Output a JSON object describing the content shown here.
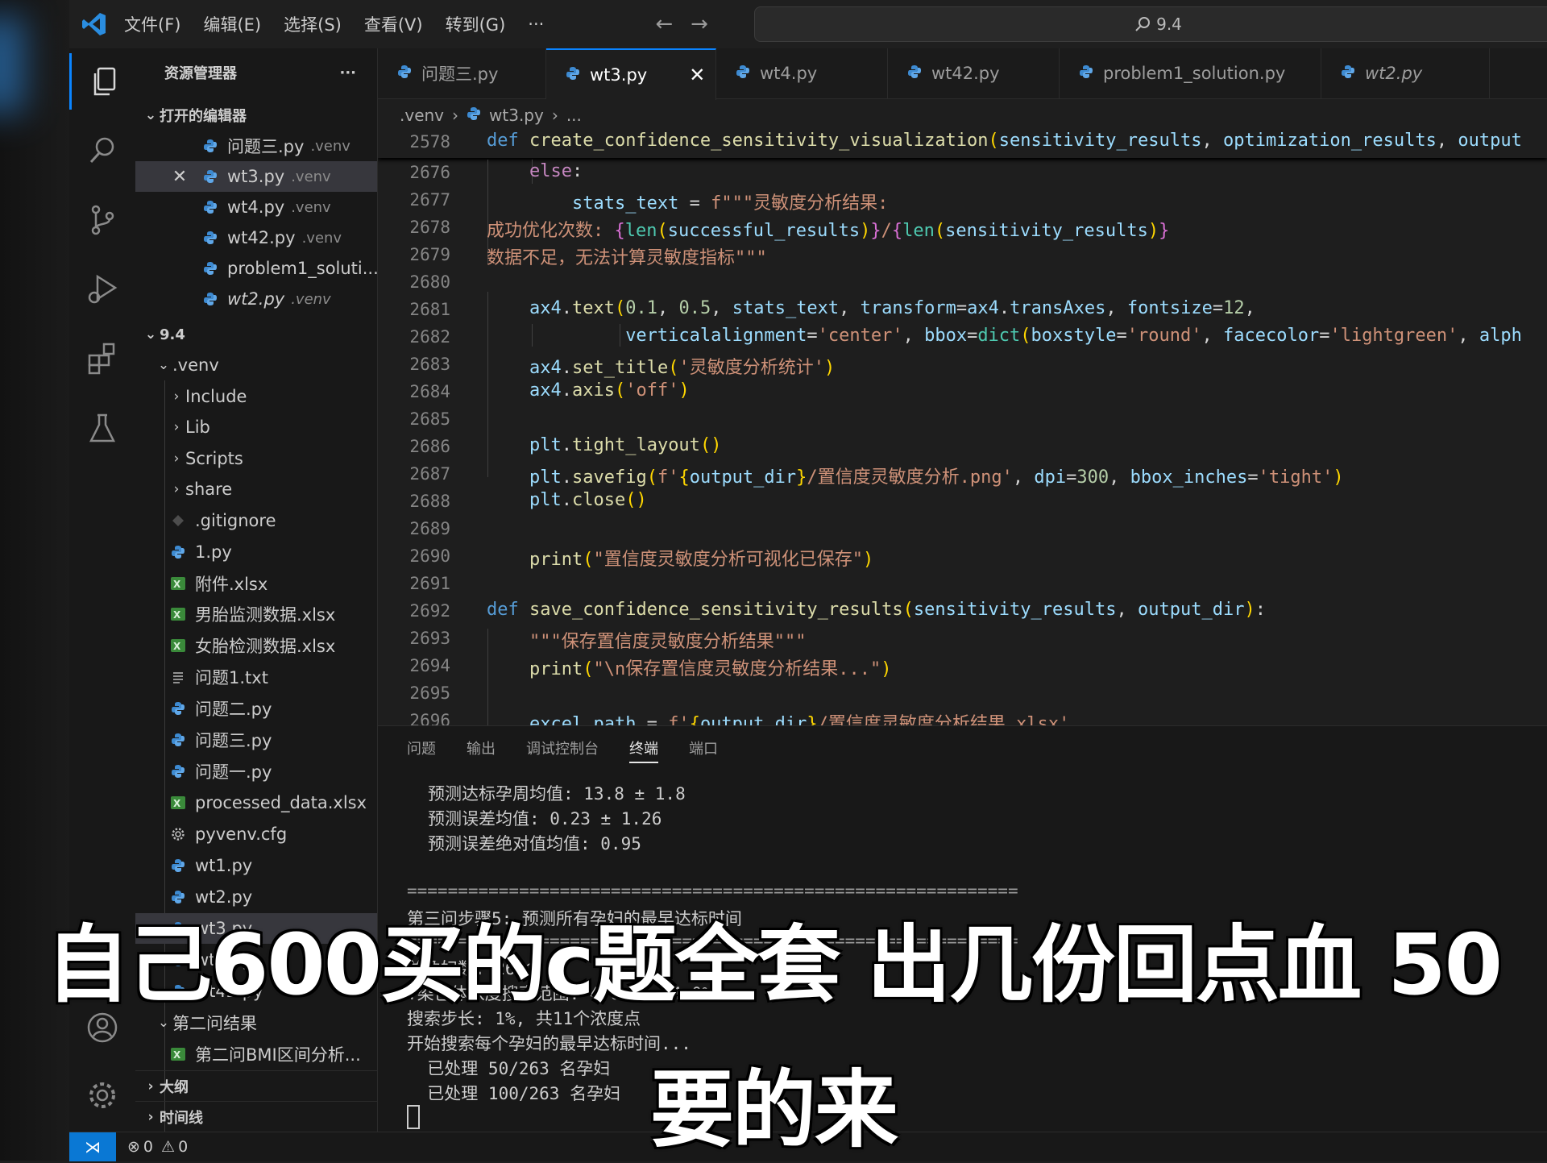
{
  "menu": [
    "文件(F)",
    "编辑(E)",
    "选择(S)",
    "查看(V)",
    "转到(G)",
    "···"
  ],
  "search": {
    "text": "9.4"
  },
  "sidebar": {
    "title": "资源管理器",
    "more": "···",
    "open_editors_label": "打开的编辑器",
    "open_editors": [
      {
        "name": "问题三.py",
        "meta": ".venv"
      },
      {
        "name": "wt3.py",
        "meta": ".venv"
      },
      {
        "name": "wt4.py",
        "meta": ".venv"
      },
      {
        "name": "wt42.py",
        "meta": ".venv"
      },
      {
        "name": "problem1_soluti...",
        "meta": ""
      },
      {
        "name": "wt2.py",
        "meta": ".venv"
      }
    ],
    "folder_label": "9.4",
    "venv_label": ".venv",
    "venv_children": [
      "Include",
      "Lib",
      "Scripts",
      "share"
    ],
    "files": [
      ".gitignore",
      "1.py",
      "附件.xlsx",
      "男胎监测数据.xlsx",
      "女胎检测数据.xlsx",
      "问题1.txt",
      "问题二.py",
      "问题三.py",
      "问题一.py",
      "processed_data.xlsx",
      "pyvenv.cfg",
      "wt1.py",
      "wt2.py",
      "wt3.py",
      "wt4.py",
      "wt42.py"
    ],
    "subfolder_label": "第二问结果",
    "subfolder_file": "第二问BMI区间分析...",
    "outline_label": "大纲",
    "timeline_label": "时间线"
  },
  "tabs": [
    {
      "label": "问题三.py"
    },
    {
      "label": "wt3.py",
      "close": "✕"
    },
    {
      "label": "wt4.py"
    },
    {
      "label": "wt42.py"
    },
    {
      "label": "problem1_solution.py"
    },
    {
      "label": "wt2.py"
    }
  ],
  "breadcrumb": {
    "folder": ".venv",
    "file": "wt3.py",
    "more": "..."
  },
  "editor": {
    "line_numbers": [
      "2578",
      "2676",
      "2677",
      "2678",
      "2679",
      "2680",
      "2681",
      "2682",
      "2683",
      "2684",
      "2685",
      "2686",
      "2687",
      "2688",
      "2689",
      "2690",
      "2691",
      "2692",
      "2693",
      "2694",
      "2695",
      "2696"
    ],
    "lines": [
      "def create_confidence_sensitivity_visualization(sensitivity_results, optimization_results, output",
      "    else:",
      "        stats_text = f\"\"\"灵敏度分析结果:",
      "成功优化次数: {len(successful_results)}/{len(sensitivity_results)}",
      "数据不足，无法计算灵敏度指标\"\"\"",
      "",
      "    ax4.text(0.1, 0.5, stats_text, transform=ax4.transAxes, fontsize=12,",
      "             verticalalignment='center', bbox=dict(boxstyle='round', facecolor='lightgreen', alph",
      "    ax4.set_title('灵敏度分析统计')",
      "    ax4.axis('off')",
      "",
      "    plt.tight_layout()",
      "    plt.savefig(f'{output_dir}/置信度灵敏度分析.png', dpi=300, bbox_inches='tight')",
      "    plt.close()",
      "",
      "    print(\"置信度灵敏度分析可视化已保存\")",
      "",
      "def save_confidence_sensitivity_results(sensitivity_results, output_dir):",
      "    \"\"\"保存置信度灵敏度分析结果\"\"\"",
      "    print(\"\\n保存置信度灵敏度分析结果...\")",
      "",
      "    excel_path = f'{output_dir}/置信度灵敏度分析结果.xlsx'"
    ]
  },
  "panel": {
    "tabs": [
      "问题",
      "输出",
      "调试控制台",
      "终端",
      "端口"
    ],
    "terminal_lines": [
      "预测达标孕周均值: 13.8 ± 1.8",
      "预测误差均值: 0.23 ± 1.26",
      "预测误差绝对值均值: 0.95",
      "",
      "============================================================",
      "第三问步骤5: 预测所有孕妇的最早达标时间",
      "============================================================",
      "总孕妇数: 263名",
      "Y染色体浓度搜索范围: 4.0% - 14.0%",
      "搜索步长: 1%, 共11个浓度点",
      "开始搜索每个孕妇的最早达标时间...",
      "  已处理 50/263 名孕妇",
      "  已处理 100/263 名孕妇"
    ]
  },
  "status": {
    "errors": "0",
    "warnings": "0"
  },
  "caption": {
    "line1": "自己600买的c题全套 出几份回点血 50",
    "line2": "要的来"
  }
}
